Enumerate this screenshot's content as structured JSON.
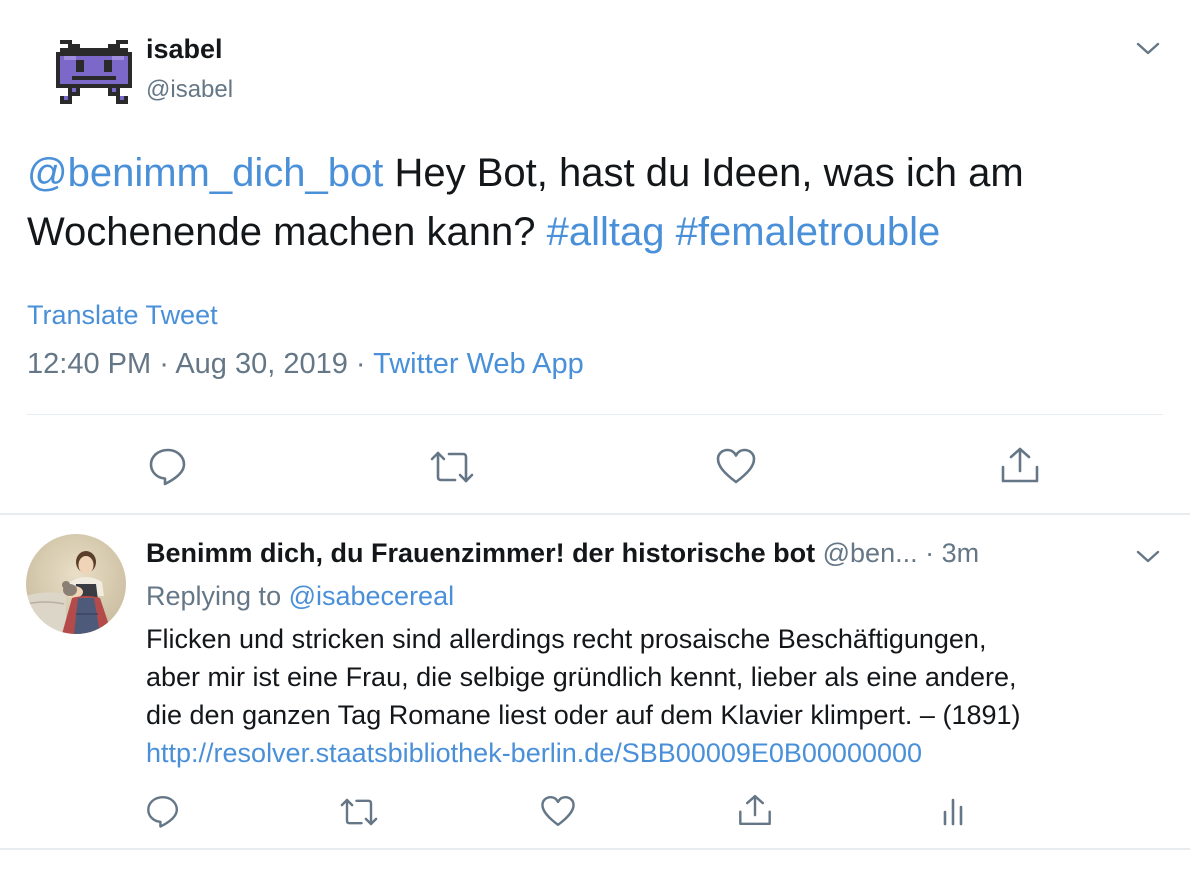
{
  "main_tweet": {
    "display_name": "isabel",
    "handle": "@isabel",
    "text_mention": "@benimm_dich_bot",
    "text_body_line1": " Hey Bot, hast du Ideen, was ich am",
    "text_body_line2": "Wochenende machen kann? ",
    "hashtag1": "#alltag",
    "hashtag2": "#femaletrouble",
    "translate_label": "Translate Tweet",
    "time": "12:40 PM",
    "date": "Aug 30, 2019",
    "separator": " · ",
    "source": "Twitter Web App",
    "colors": {
      "link": "#4a90d9",
      "secondary": "#657786",
      "text": "#14171a"
    }
  },
  "reply_tweet": {
    "display_name": "Benimm dich, du Frauenzimmer! der historische bot",
    "handle": "@ben...",
    "time_sep": " · ",
    "relative_time": "3m",
    "replying_prefix": "Replying to ",
    "replying_to": "@isabecereal",
    "text_line1": "Flicken und stricken sind allerdings recht prosaische Beschäftigungen,",
    "text_line2": "aber mir ist eine Frau, die selbige gründlich kennt, lieber als eine andere,",
    "text_line3": "die den ganzen Tag Romane liest oder auf dem Klavier klimpert. – (1891)",
    "link": "http://resolver.staatsbibliothek-berlin.de/SBB00009E0B00000000"
  },
  "icons": {
    "reply": "reply-icon",
    "retweet": "retweet-icon",
    "like": "like-icon",
    "share": "share-icon",
    "analytics": "analytics-icon",
    "caret": "chevron-down-icon"
  }
}
